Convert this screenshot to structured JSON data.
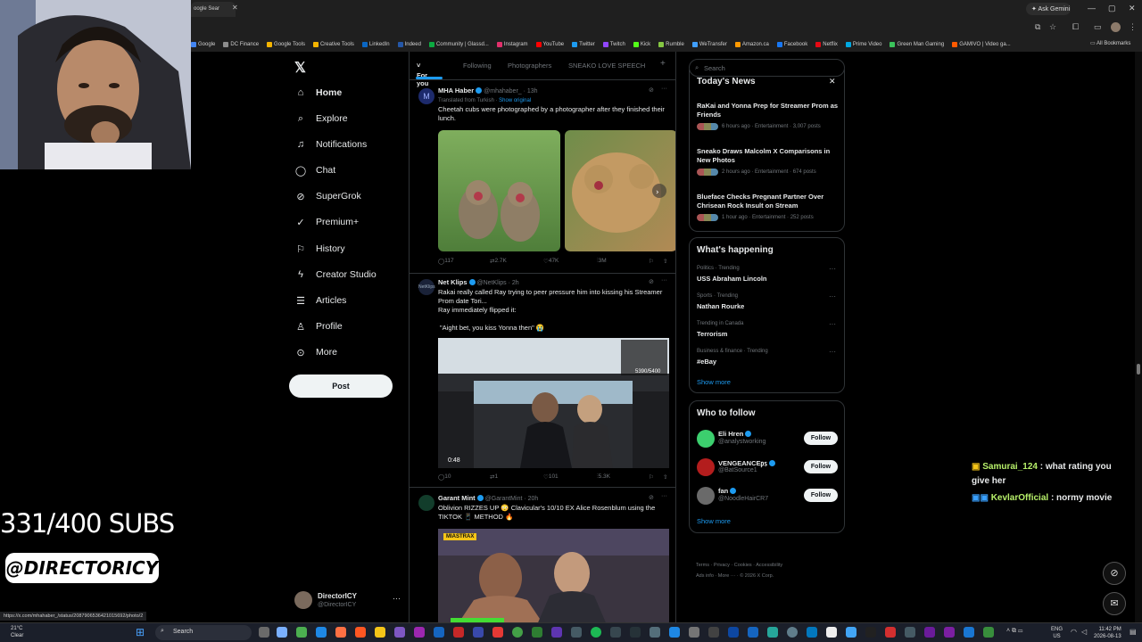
{
  "browser": {
    "tab_title": "oogle Sear",
    "ask_gemini": "Ask Gemini",
    "bookmarks": [
      "Google",
      "DC Finance",
      "Google Tools",
      "Creative Tools",
      "LinkedIn",
      "Indeed",
      "Community | Glassd...",
      "Instagram",
      "YouTube",
      "Twitter",
      "Twitch",
      "Kick",
      "Rumble",
      "WeTransfer",
      "Amazon.ca",
      "Facebook",
      "Netflix",
      "Prime Video",
      "Green Man Gaming",
      "GAMIVO | Video ga..."
    ],
    "all_bookmarks": "All Bookmarks",
    "status_url": "https://x.com/mhahaber_/status/2087906536421015692/photo/2"
  },
  "nav": {
    "items": [
      "Home",
      "Explore",
      "Notifications",
      "Chat",
      "SuperGrok",
      "Premium+",
      "History",
      "Creator Studio",
      "Articles",
      "Profile",
      "More"
    ],
    "post_label": "Post",
    "user_name": "DirectorICY",
    "user_handle": "@DirectorICY"
  },
  "feed": {
    "tabs": [
      "For you",
      "Following",
      "Photographers",
      "SNEAKO LOVE SPEECH"
    ],
    "posts": [
      {
        "name": "MHA Haber",
        "handle": "@mhahaber_ · 13h",
        "translated": "Translated from Turkish",
        "show_original": "Show original",
        "text": "Cheetah cubs were photographed by a photographer after they finished their lunch.",
        "replies": "117",
        "reposts": "2.7K",
        "likes": "47K",
        "views": "3M"
      },
      {
        "name": "Net Klips",
        "handle": "@NetKlips · 2h",
        "text1": "Rakai really called Ray trying to peer pressure him into kissing his Streamer Prom date Tori...",
        "text2": "Ray immediately flipped it:",
        "text3": "\"Aight bet, you kiss Yonna then\" 😭",
        "video_time": "0:48",
        "video_count": "5390/5400",
        "replies": "10",
        "reposts": "1",
        "likes": "101",
        "views": "5.3K"
      },
      {
        "name": "Garant Mint",
        "handle": "@GarantMint · 20h",
        "text": "Oblivion RIZZES UP 😳 Clavicular's 10/10 EX Alice Rosenblum using the TIKTOK 📱 METHOD 🔥",
        "overlay": "MIASTRAX"
      }
    ]
  },
  "right": {
    "search_placeholder": "Search",
    "news_title": "Today's News",
    "news": [
      {
        "title": "RaKai and Yonna Prep for Streamer Prom as Friends",
        "meta": "6 hours ago · Entertainment · 3,007 posts"
      },
      {
        "title": "Sneako Draws Malcolm X Comparisons in New Photos",
        "meta": "2 hours ago · Entertainment · 674 posts"
      },
      {
        "title": "Blueface Checks Pregnant Partner Over Chrisean Rock Insult on Stream",
        "meta": "1 hour ago · Entertainment · 252 posts"
      }
    ],
    "happening_title": "What's happening",
    "trends": [
      {
        "context": "Politics · Trending",
        "name": "USS Abraham Lincoln"
      },
      {
        "context": "Sports · Trending",
        "name": "Nathan Rourke"
      },
      {
        "context": "Trending in Canada",
        "name": "Terrorism"
      },
      {
        "context": "Business & finance · Trending",
        "name": "#eBay"
      }
    ],
    "show_more": "Show more",
    "follow_title": "Who to follow",
    "follow": [
      {
        "name": "Eli Hren",
        "handle": "@analystworking",
        "color": "#3ccf6e"
      },
      {
        "name": "VENGEANCE㎰",
        "handle": "@BatSource1",
        "color": "#b31d1d"
      },
      {
        "name": "fan",
        "handle": "@NoodleHairCR7",
        "color": "#6a6a6a"
      }
    ],
    "follow_label": "Follow",
    "footer_line1": "Terms · Privacy · Cookies · Accessibility",
    "footer_line2": "Ads info · More ··· · © 2026 X Corp."
  },
  "overlay": {
    "subs": "331/400 SUBS",
    "brand": "@DIRECTORICY",
    "chat": [
      {
        "user": "Samurai_124",
        "msg": " : what rating you"
      },
      {
        "user": "",
        "msg": "give her"
      },
      {
        "user": "KevlarOfficial",
        "msg": " : normy movie"
      }
    ]
  },
  "taskbar": {
    "search": "Search",
    "temp": "21°C",
    "weather": "Clear",
    "lang1": "ENG",
    "lang2": "US",
    "time": "11:42 PM",
    "date": "2026-08-13"
  },
  "colors": {
    "accent": "#1d9bf0",
    "bg": "#000000",
    "border": "#2f3336"
  }
}
